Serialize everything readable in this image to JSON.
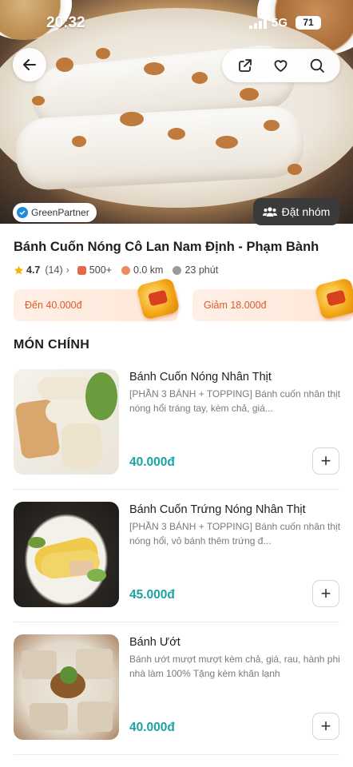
{
  "status_bar": {
    "time": "20:32",
    "network": "5G",
    "battery": "71"
  },
  "store": {
    "partner_badge": "GreenPartner",
    "group_order_label": "Đặt nhóm",
    "name": "Bánh Cuốn Nóng Cô Lan Nam Định - Phạm Bành",
    "rating": "4.7",
    "rating_count": "(14)",
    "orders": "500+",
    "distance": "0.0 km",
    "eta": "23 phút"
  },
  "promos": [
    {
      "label": "Đến 40.000đ"
    },
    {
      "label": "Giảm 18.000đ"
    }
  ],
  "section": {
    "title": "MÓN CHÍNH"
  },
  "items": [
    {
      "name": "Bánh Cuốn Nóng Nhân Thịt",
      "description": "[PHẦN 3 BÁNH + TOPPING] Bánh cuốn nhân thịt nóng hổi tráng tay, kèm chả, giá...",
      "price": "40.000đ",
      "add_label": "+"
    },
    {
      "name": "Bánh Cuốn Trứng Nóng Nhân Thịt",
      "description": "[PHẦN 3 BÁNH + TOPPING] Bánh cuốn nhân thịt nóng hổi, vỏ bánh thêm trứng đ...",
      "price": "45.000đ",
      "add_label": "+"
    },
    {
      "name": "Bánh Ướt",
      "description": "Bánh ướt mượt mượt kèm chả, giá, rau, hành phi nhà làm 100% Tặng kèm khăn lạnh",
      "price": "40.000đ",
      "add_label": "+"
    }
  ],
  "icons": {
    "back": "arrow-left-icon",
    "share": "share-icon",
    "favorite": "heart-icon",
    "search": "search-icon",
    "partner": "check-badge-icon",
    "group": "group-icon",
    "star": "star-icon"
  },
  "colors": {
    "price": "#1aa3a3",
    "promo_text": "#e05a2b",
    "partner_badge": "#1e8bd8"
  }
}
